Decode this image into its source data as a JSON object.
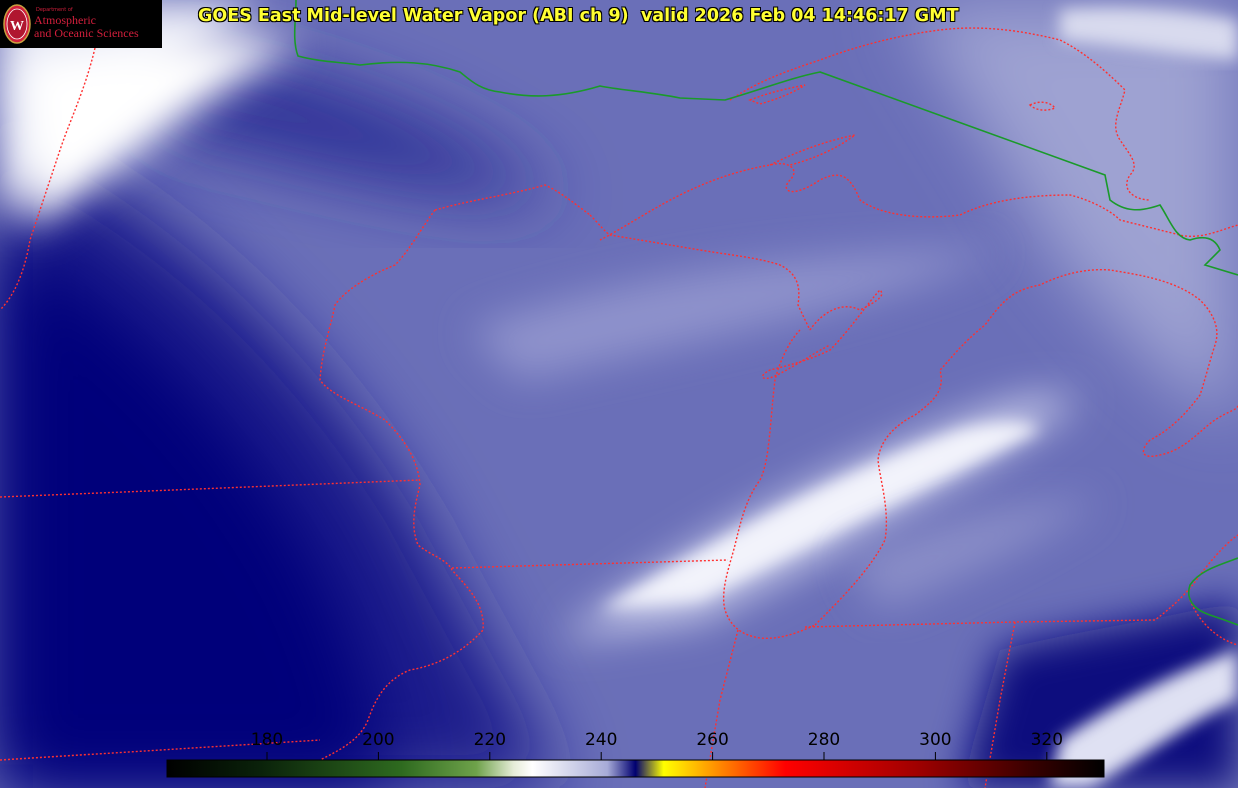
{
  "title": "GOES East Mid-level Water Vapor (ABI ch 9)  valid 2026 Feb 04 14:46:17 GMT",
  "logo": {
    "icon": "uw-crest-icon",
    "department_line": "Department of",
    "name_line1": "Atmospheric",
    "name_line2": "and Oceanic Sciences"
  },
  "colorbar": {
    "ticks": [
      {
        "value": "180"
      },
      {
        "value": "200"
      },
      {
        "value": "220"
      },
      {
        "value": "240"
      },
      {
        "value": "260"
      },
      {
        "value": "280"
      },
      {
        "value": "300"
      },
      {
        "value": "320"
      }
    ],
    "stops": [
      "#000000",
      "#0c2a0c",
      "#2f6a1e",
      "#5e9b3a",
      "#ffffff",
      "#b8bde0",
      "#000078",
      "#ffff00",
      "#ff8000",
      "#ff0000",
      "#b00000",
      "#400000",
      "#000000"
    ]
  },
  "map": {
    "colors": {
      "state_border": "#ff3030",
      "international_border": "#1a9a2a",
      "deep_dry": "#030377",
      "base": "#5a5fae",
      "cloud": "#ffffff"
    }
  }
}
